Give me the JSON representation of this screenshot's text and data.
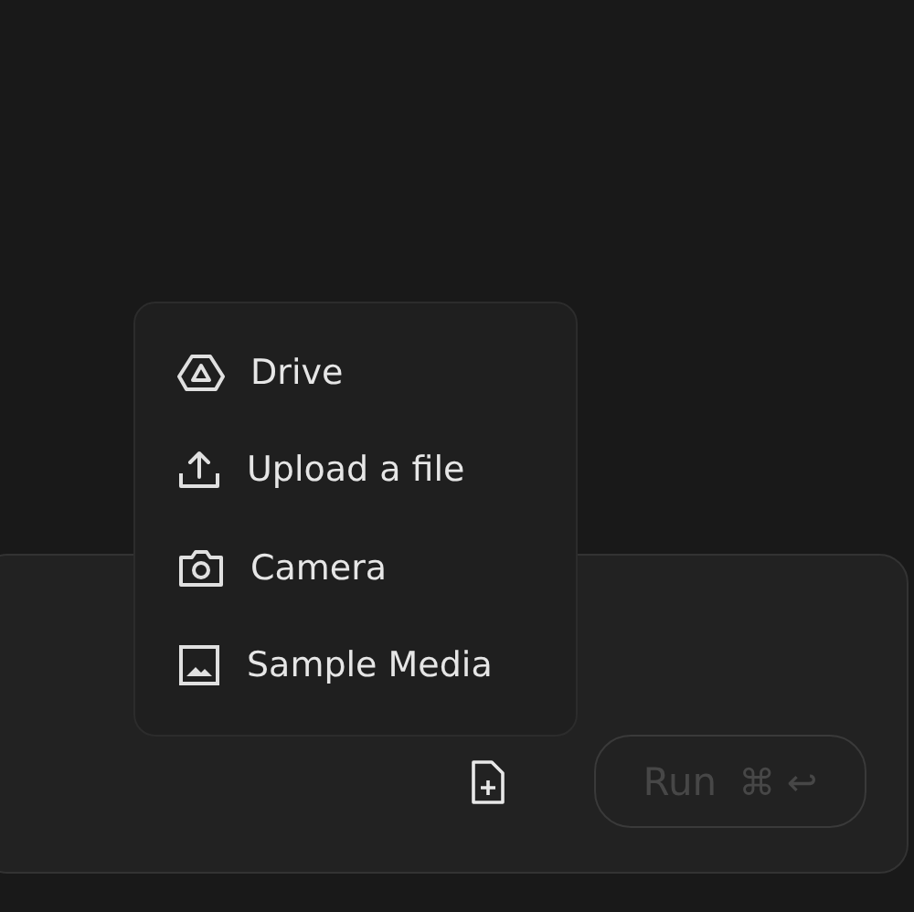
{
  "menu": {
    "items": [
      {
        "label": "Drive"
      },
      {
        "label": "Upload a file"
      },
      {
        "label": "Camera"
      },
      {
        "label": "Sample Media"
      }
    ]
  },
  "run_button": {
    "label": "Run",
    "shortcut": "⌘ ↩",
    "disabled": true
  }
}
